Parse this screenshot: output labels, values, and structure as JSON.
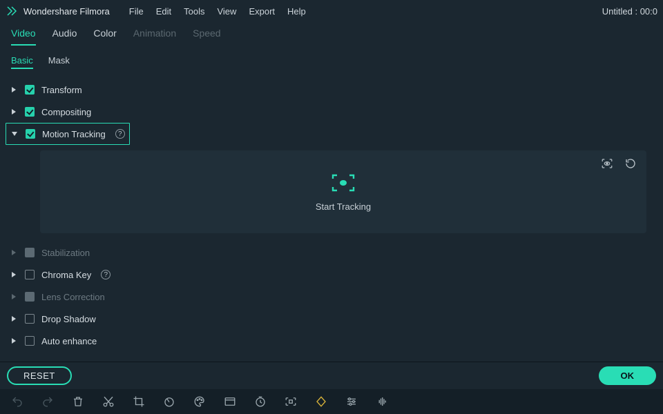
{
  "app": {
    "title": "Wondershare Filmora",
    "document_title": "Untitled : 00:0"
  },
  "menu": {
    "items": [
      "File",
      "Edit",
      "Tools",
      "View",
      "Export",
      "Help"
    ]
  },
  "primary_tabs": {
    "items": [
      {
        "label": "Video",
        "active": true
      },
      {
        "label": "Audio",
        "active": false
      },
      {
        "label": "Color",
        "active": false
      },
      {
        "label": "Animation",
        "active": false,
        "disabled": true
      },
      {
        "label": "Speed",
        "active": false,
        "disabled": true
      }
    ]
  },
  "sub_tabs": {
    "items": [
      {
        "label": "Basic",
        "active": true
      },
      {
        "label": "Mask",
        "active": false
      }
    ]
  },
  "sections": [
    {
      "label": "Transform",
      "checked": true,
      "expanded": false
    },
    {
      "label": "Compositing",
      "checked": true,
      "expanded": false
    },
    {
      "label": "Motion Tracking",
      "checked": true,
      "expanded": true,
      "help": true,
      "highlight": true
    },
    {
      "label": "Stabilization",
      "checked": "neutral",
      "expanded": false,
      "muted": true
    },
    {
      "label": "Chroma Key",
      "checked": false,
      "expanded": false,
      "help": true
    },
    {
      "label": "Lens Correction",
      "checked": "neutral",
      "expanded": false,
      "muted": true
    },
    {
      "label": "Drop Shadow",
      "checked": false,
      "expanded": false
    },
    {
      "label": "Auto enhance",
      "checked": false,
      "expanded": false
    }
  ],
  "tracking_panel": {
    "start_label": "Start Tracking"
  },
  "actions": {
    "reset": "RESET",
    "ok": "OK"
  },
  "toolbar": {
    "icons": [
      "undo-icon",
      "redo-icon",
      "delete-icon",
      "cut-icon",
      "crop-icon",
      "speed-icon",
      "color-icon",
      "green-screen-icon",
      "duration-icon",
      "freeze-icon",
      "keyframe-icon",
      "adjust-icon",
      "audio-icon"
    ]
  },
  "colors": {
    "accent": "#29ddb5",
    "bg": "#1b2730",
    "panel": "#202f39"
  }
}
